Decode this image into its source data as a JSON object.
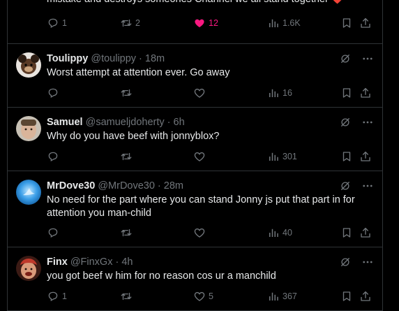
{
  "top_tweet": {
    "text": "mistake and destroys someones Channel we all stand together ❤️",
    "reply_count": "1",
    "retweet_count": "2",
    "like_count": "12",
    "view_count": "1.6K"
  },
  "tweets": [
    {
      "name": "Toulippy",
      "handle": "@toulippy",
      "sep": "·",
      "time": "18m",
      "text": "Worst attempt at attention ever. Go away",
      "reply_count": "",
      "retweet_count": "",
      "like_count": "",
      "view_count": "16",
      "avatar_color": "#6b4a36"
    },
    {
      "name": "Samuel",
      "handle": "@samueljdoherty",
      "sep": "·",
      "time": "6h",
      "text": "Why do you have beef with jonnyblox?",
      "reply_count": "",
      "retweet_count": "",
      "like_count": "",
      "view_count": "301",
      "avatar_color": "#a89a8a"
    },
    {
      "name": "MrDove30",
      "handle": "@MrDove30",
      "sep": "·",
      "time": "28m",
      "text": "No need for the part where you can stand Jonny js put that part in for attention you man-child",
      "reply_count": "",
      "retweet_count": "",
      "like_count": "",
      "view_count": "40",
      "avatar_color": "#2b8fd8"
    },
    {
      "name": "Finx",
      "handle": "@FinxGx",
      "sep": "·",
      "time": "4h",
      "text": "you got beef w him for no reason cos ur a manchild",
      "reply_count": "1",
      "retweet_count": "",
      "like_count": "5",
      "view_count": "367",
      "avatar_color": "#c0392b"
    }
  ],
  "icons": {
    "reply": "reply-icon",
    "retweet": "retweet-icon",
    "like": "heart-icon",
    "views": "views-icon",
    "bookmark": "bookmark-icon",
    "share": "share-icon",
    "grok": "grok-icon",
    "more": "more-icon"
  },
  "colors": {
    "background": "#000000",
    "text": "#e7e9ea",
    "muted": "#71767b",
    "border": "#2f3336",
    "like_active": "#f91880"
  }
}
